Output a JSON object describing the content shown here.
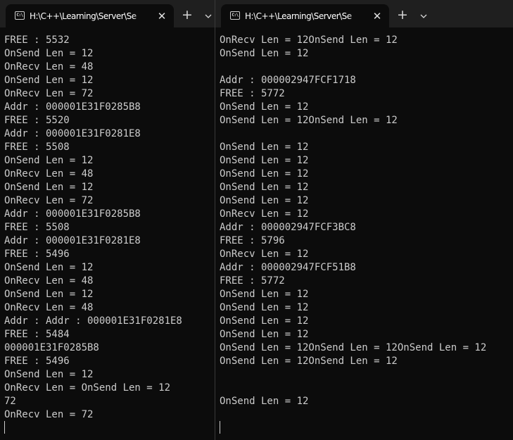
{
  "left_window": {
    "tab_title": "H:\\C++\\Learning\\Server\\Se",
    "tab_icon_text": "C:\\",
    "close_glyph": "✕",
    "new_tab_glyph": "+",
    "output_lines": [
      "FREE : 5532",
      "OnSend Len = 12",
      "OnRecv Len = 48",
      "OnSend Len = 12",
      "OnRecv Len = 72",
      "Addr : 000001E31F0285B8",
      "FREE : 5520",
      "Addr : 000001E31F0281E8",
      "FREE : 5508",
      "OnSend Len = 12",
      "OnRecv Len = 48",
      "OnSend Len = 12",
      "OnRecv Len = 72",
      "Addr : 000001E31F0285B8",
      "FREE : 5508",
      "Addr : 000001E31F0281E8",
      "FREE : 5496",
      "OnSend Len = 12",
      "OnRecv Len = 48",
      "OnSend Len = 12",
      "OnRecv Len = 48",
      "Addr : Addr : 000001E31F0281E8",
      "FREE : 5484",
      "000001E31F0285B8",
      "FREE : 5496",
      "OnSend Len = 12",
      "OnRecv Len = OnSend Len = 12",
      "72",
      "OnRecv Len = 72"
    ]
  },
  "right_window": {
    "tab_title": "H:\\C++\\Learning\\Server\\Se",
    "tab_icon_text": "C:\\",
    "close_glyph": "✕",
    "new_tab_glyph": "+",
    "output_lines": [
      "OnRecv Len = 12OnSend Len = 12",
      "OnSend Len = 12",
      "",
      "Addr : 000002947FCF1718",
      "FREE : 5772",
      "OnSend Len = 12",
      "OnSend Len = 12OnSend Len = 12",
      "",
      "OnSend Len = 12",
      "OnSend Len = 12",
      "OnSend Len = 12",
      "OnSend Len = 12",
      "OnSend Len = 12",
      "OnRecv Len = 12",
      "Addr : 000002947FCF3BC8",
      "FREE : 5796",
      "OnRecv Len = 12",
      "Addr : 000002947FCF51B8",
      "FREE : 5772",
      "OnSend Len = 12",
      "OnSend Len = 12",
      "OnSend Len = 12",
      "OnSend Len = 12",
      "OnSend Len = 12OnSend Len = 12OnSend Len = 12",
      "OnSend Len = 12OnSend Len = 12",
      "",
      "",
      "OnSend Len = 12"
    ]
  }
}
